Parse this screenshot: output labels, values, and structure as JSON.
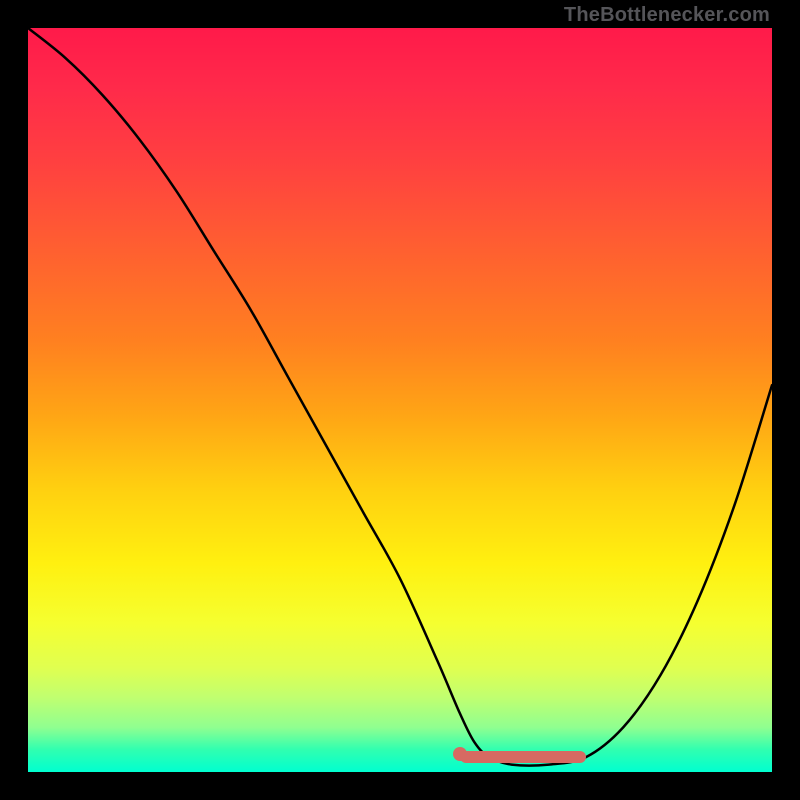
{
  "attribution": "TheBottlenecker.com",
  "chart_data": {
    "type": "line",
    "title": "",
    "xlabel": "",
    "ylabel": "",
    "xlim": [
      0,
      100
    ],
    "ylim": [
      0,
      100
    ],
    "series": [
      {
        "name": "bottleneck-curve",
        "x": [
          0,
          5,
          10,
          15,
          20,
          25,
          30,
          35,
          40,
          45,
          50,
          55,
          58,
          60,
          62,
          65,
          70,
          75,
          80,
          85,
          90,
          95,
          100
        ],
        "values": [
          100,
          96,
          91,
          85,
          78,
          70,
          62,
          53,
          44,
          35,
          26,
          15,
          8,
          4,
          2,
          1,
          1,
          2,
          6,
          13,
          23,
          36,
          52
        ]
      }
    ],
    "optimal_band": {
      "x_start": 58,
      "x_end": 75,
      "y": 2
    },
    "background_gradient": {
      "top": "#ff1a4a",
      "bottom": "#00ffd0"
    }
  }
}
